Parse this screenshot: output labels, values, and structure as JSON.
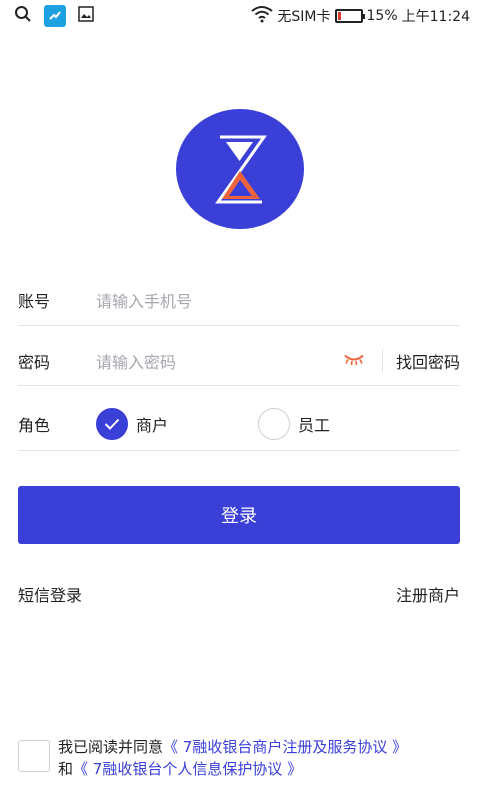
{
  "status_bar": {
    "sim": "无SIM卡",
    "battery_level": 0.15,
    "battery": "15%",
    "time": "上午11:24",
    "icons": [
      "search-icon",
      "app-notification-icon",
      "image-icon",
      "wifi-icon",
      "battery-icon"
    ]
  },
  "form": {
    "account_label": "账号",
    "account_placeholder": "请输入手机号",
    "password_label": "密码",
    "password_placeholder": "请输入密码",
    "forgot_password": "找回密码",
    "role_label": "角色",
    "roles": [
      {
        "label": "商户",
        "checked": true
      },
      {
        "label": "员工",
        "checked": false
      }
    ]
  },
  "login_button": "登录",
  "links": {
    "sms_login": "短信登录",
    "register": "注册商户"
  },
  "agreement": {
    "prefix": "我已阅读并同意",
    "service_agreement": "《 7融收银台商户注册及服务协议 》",
    "conjunction": "和",
    "privacy_agreement": "《 7融收银台个人信息保护协议 》",
    "checked": false
  },
  "colors": {
    "primary": "#3a3fd8",
    "logo_accent": "#f0643c",
    "placeholder": "#a6a6b0"
  }
}
